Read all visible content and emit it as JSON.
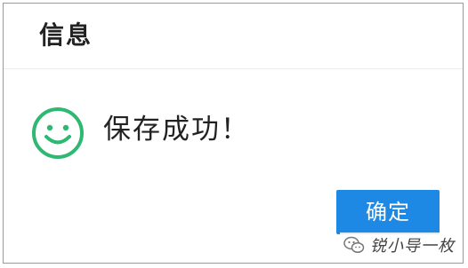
{
  "dialog": {
    "title": "信息",
    "icon": "smiley-success-icon",
    "message": "保存成功！",
    "confirm_label": "确定"
  },
  "watermark": {
    "icon": "wechat-icon",
    "text": "锐小导一枚"
  },
  "colors": {
    "accent": "#1e88e5",
    "success": "#2eb872",
    "title_text": "#222222",
    "border": "#9a9a9a"
  }
}
